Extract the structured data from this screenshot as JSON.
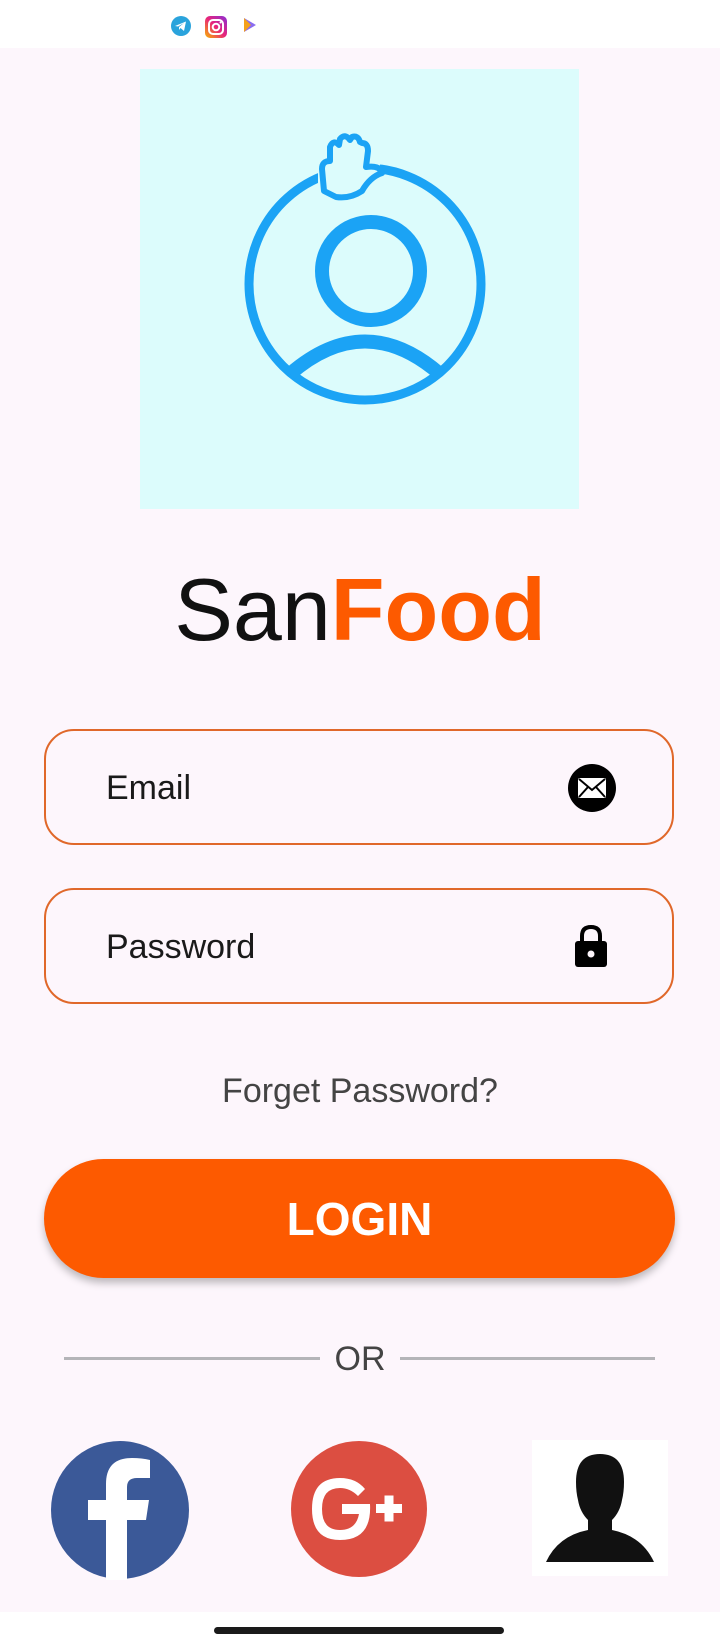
{
  "status_bar": {
    "icons": [
      "telegram-icon",
      "instagram-icon",
      "play-store-icon"
    ]
  },
  "logo": {
    "icon": "user-wave-icon",
    "color": "#1ba3f5",
    "background": "#dcfcfc"
  },
  "brand": {
    "part1": "San",
    "part2": "Food",
    "accent_color": "#fd5a00"
  },
  "form": {
    "email_placeholder": "Email",
    "password_placeholder": "Password",
    "email_icon": "envelope-icon",
    "password_icon": "lock-icon",
    "border_color": "#e0682a"
  },
  "forget_label": "Forget Password?",
  "login_label": "LOGIN",
  "or_label": "OR",
  "social": [
    {
      "name": "Facebook",
      "icon": "facebook-icon",
      "color": "#3b5998"
    },
    {
      "name": "Google Plus",
      "icon": "google-plus-icon",
      "color": "#dc4e41"
    },
    {
      "name": "Guest",
      "icon": "person-silhouette-icon",
      "color": "#111111"
    }
  ]
}
